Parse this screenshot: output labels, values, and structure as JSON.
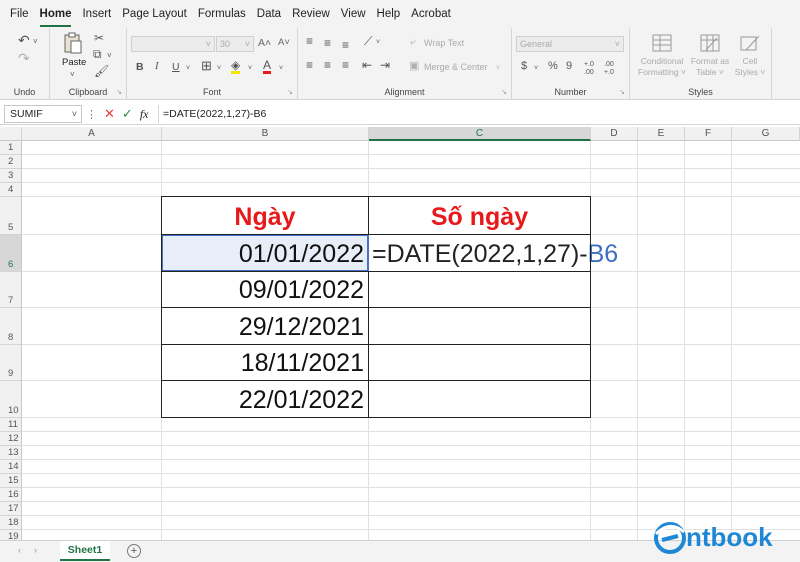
{
  "menu": {
    "tabs": [
      "File",
      "Home",
      "Insert",
      "Page Layout",
      "Formulas",
      "Data",
      "Review",
      "View",
      "Help",
      "Acrobat"
    ],
    "active": "Home"
  },
  "ribbon": {
    "undo_label": "Undo",
    "clipboard_label": "Clipboard",
    "paste_label": "Paste",
    "font_label": "Font",
    "font_size": "30",
    "bold": "B",
    "italic": "I",
    "underline": "U",
    "grow_font": "A˄",
    "shrink_font": "A˅",
    "alignment_label": "Alignment",
    "wrap_text": "Wrap Text",
    "merge_center": "Merge & Center",
    "number_label": "Number",
    "number_format": "General",
    "currency": "$",
    "percent": "%",
    "comma": "9",
    "inc_decimal": "+.0 .00",
    "dec_decimal": ".00 +.0",
    "styles_label": "Styles",
    "conditional": [
      "Conditional",
      "Formatting"
    ],
    "format_as": [
      "Format as",
      "Table"
    ],
    "cell_styles": [
      "Cell",
      "Styles"
    ]
  },
  "formula_bar": {
    "name_box": "SUMIF",
    "fx": "fx",
    "formula": "=DATE(2022,1,27)-B6"
  },
  "columns": [
    "A",
    "B",
    "C",
    "D",
    "E",
    "F",
    "G"
  ],
  "rows": [
    "1",
    "2",
    "3",
    "4",
    "5",
    "6",
    "7",
    "8",
    "9",
    "10",
    "11",
    "12",
    "13",
    "14",
    "15",
    "16",
    "17",
    "18",
    "19"
  ],
  "table": {
    "header_b": "Ngày",
    "header_c": "Số ngày",
    "dates": [
      "01/01/2022",
      "09/01/2022",
      "29/12/2021",
      "18/11/2021",
      "22/01/2022"
    ],
    "edit_prefix": "=DATE(2022,1,27)-",
    "edit_ref": "B6"
  },
  "sheet": {
    "name": "Sheet1"
  },
  "logo": {
    "text": "ntbook"
  },
  "colors": {
    "accent": "#217346",
    "header_text": "#e8191a",
    "ref_blue": "#3c6fc4",
    "logo_blue": "#1e88d6"
  }
}
